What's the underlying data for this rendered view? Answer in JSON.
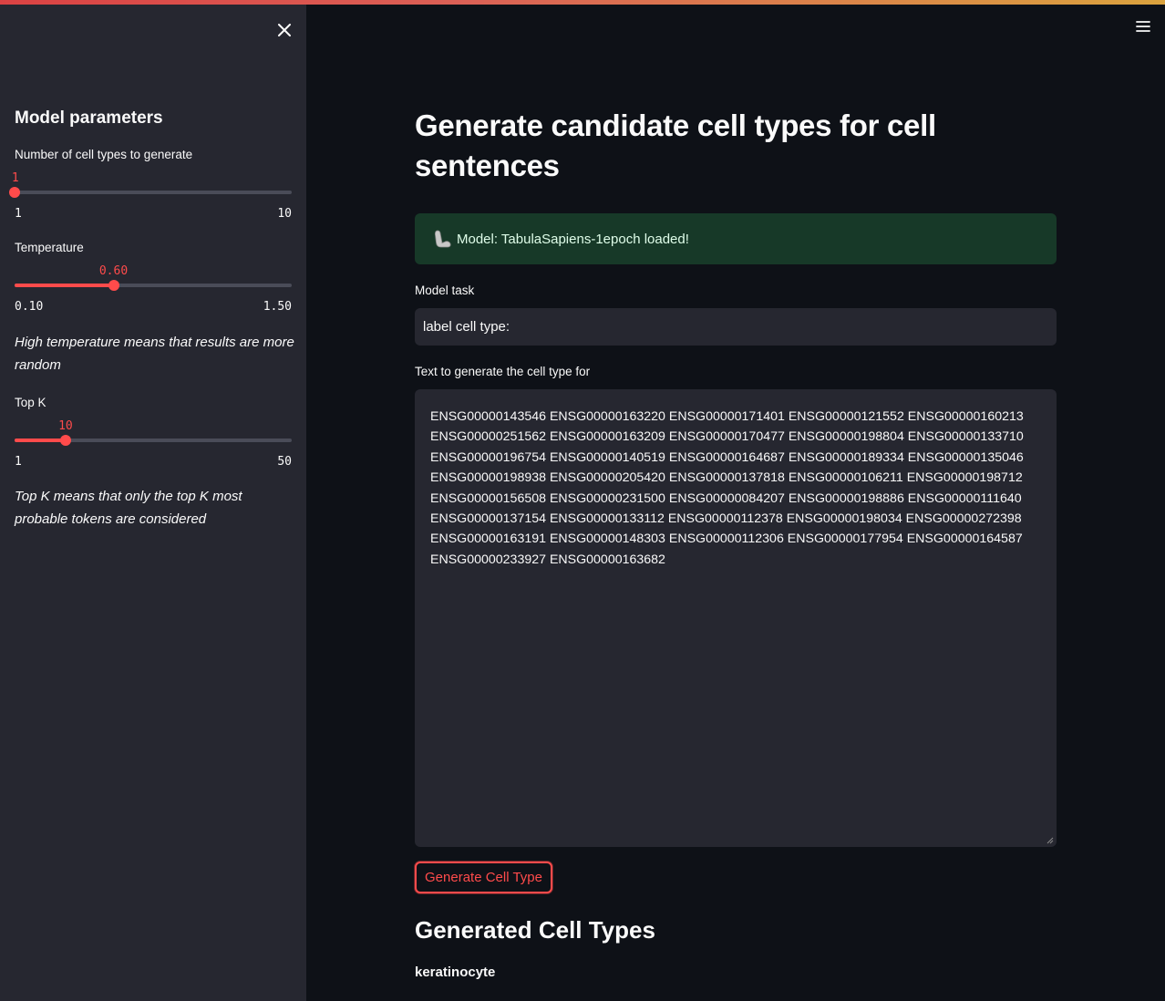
{
  "sidebar": {
    "title": "Model parameters",
    "num_types": {
      "label": "Number of cell types to generate",
      "value": "1",
      "min": "1",
      "max": "10",
      "fraction": 0.0
    },
    "temperature": {
      "label": "Temperature",
      "value": "0.60",
      "min": "0.10",
      "max": "1.50",
      "fraction": 0.357
    },
    "temperature_caption": "High temperature means that results are more random",
    "top_k": {
      "label": "Top K",
      "value": "10",
      "min": "1",
      "max": "50",
      "fraction": 0.184
    },
    "top_k_caption": "Top K means that only the top K most probable tokens are considered"
  },
  "main": {
    "title": "Generate candidate cell types for cell sentences",
    "alert": "Model: TabulaSapiens-1epoch loaded!",
    "model_task_label": "Model task",
    "model_task_value": "label cell type:",
    "text_label": "Text to generate the cell type for",
    "text_value": "ENSG00000143546 ENSG00000163220 ENSG00000171401 ENSG00000121552 ENSG00000160213 ENSG00000251562 ENSG00000163209 ENSG00000170477 ENSG00000198804 ENSG00000133710 ENSG00000196754 ENSG00000140519 ENSG00000164687 ENSG00000189334 ENSG00000135046 ENSG00000198938 ENSG00000205420 ENSG00000137818 ENSG00000106211 ENSG00000198712 ENSG00000156508 ENSG00000231500 ENSG00000084207 ENSG00000198886 ENSG00000111640 ENSG00000137154 ENSG00000133112 ENSG00000112378 ENSG00000198034 ENSG00000272398 ENSG00000163191 ENSG00000148303 ENSG00000112306 ENSG00000177954 ENSG00000164587 ENSG00000233927 ENSG00000163682",
    "generate_button": "Generate Cell Type",
    "results_title": "Generated Cell Types",
    "results": [
      "keratinocyte"
    ]
  },
  "icons": {
    "close": "close-icon",
    "menu": "hamburger-menu-icon",
    "alert": "flexed-arm-icon"
  },
  "colors": {
    "accent": "#ff4b4b",
    "sidebar_bg": "#262730",
    "main_bg": "#0e1117",
    "success_bg": "#173928"
  }
}
